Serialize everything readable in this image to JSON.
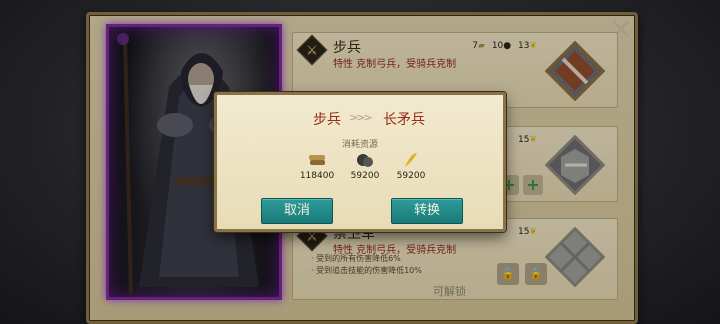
{
  "rows": [
    {
      "name": "步兵",
      "trait": "特性 克制弓兵，受骑兵克制",
      "costs": [
        "7",
        "10",
        "13"
      ]
    },
    {
      "costs": [
        "15"
      ]
    },
    {
      "name": "禁卫军",
      "trait": "特性 克制弓兵，受骑兵克制",
      "costs": [
        "15"
      ],
      "bullets": [
        "受到的所有伤害降低6%",
        "受到追击技能的伤害降低10%"
      ],
      "unlock_label": "可解锁"
    }
  ],
  "dialog": {
    "from_unit": "步兵",
    "arrow": ">>>",
    "to_unit": "长矛兵",
    "consume_label": "消耗资源",
    "resources": [
      {
        "icon": "wood-icon",
        "value": "118400"
      },
      {
        "icon": "iron-ore-icon",
        "value": "59200"
      },
      {
        "icon": "grain-icon",
        "value": "59200"
      }
    ],
    "cancel_label": "取消",
    "confirm_label": "转换"
  },
  "colors": {
    "accent_teal": "#1a7a78",
    "trait_red": "#8a2a20",
    "portrait_border": "#7a2a9a"
  }
}
